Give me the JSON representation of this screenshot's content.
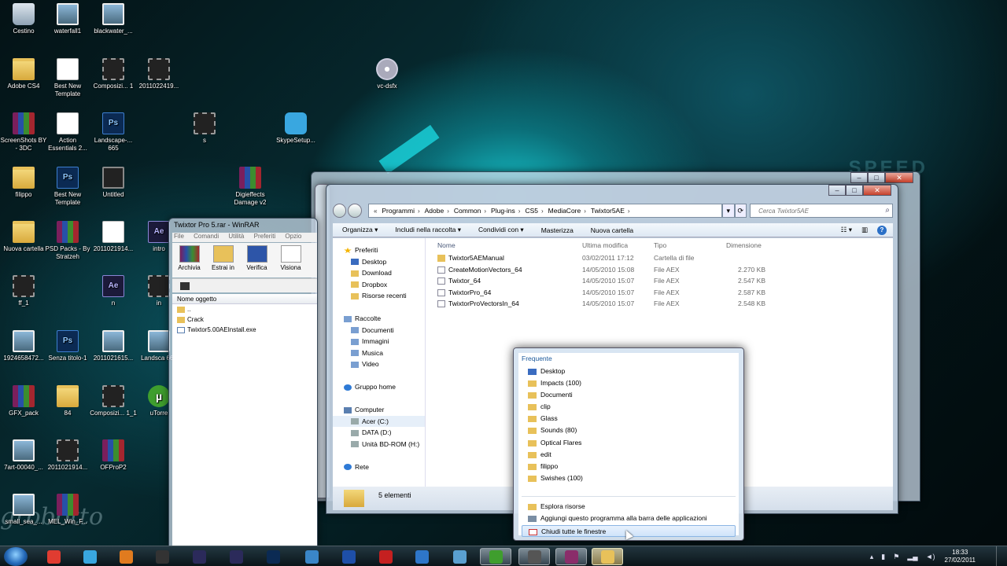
{
  "desktop": {
    "watermark": "grobotto",
    "wallpaper_text": "SPEED",
    "icons": [
      {
        "label": "Cestino",
        "icon": "trash-icon"
      },
      {
        "label": "waterfall1",
        "icon": "image-icon"
      },
      {
        "label": "blackwater_...",
        "icon": "image-icon"
      },
      {
        "label": "Adobe CS4",
        "icon": "folder-icon"
      },
      {
        "label": "Best New Template",
        "icon": "document-icon"
      },
      {
        "label": "Composizi... 1",
        "icon": "video-icon"
      },
      {
        "label": "2011022419...",
        "icon": "video-icon"
      },
      {
        "label": "vc-dsfx",
        "icon": "disc-icon"
      },
      {
        "label": "ScreenShots BY - 3DC",
        "icon": "rar-icon"
      },
      {
        "label": "Action Essentials 2...",
        "icon": "document-icon"
      },
      {
        "label": "Landscape-... 665",
        "icon": "psd-icon"
      },
      {
        "label": "s",
        "icon": "video-icon"
      },
      {
        "label": "SkypeSetup...",
        "icon": "skype-icon"
      },
      {
        "label": "filippo",
        "icon": "folder-icon"
      },
      {
        "label": "Best New Template",
        "icon": "psd-icon"
      },
      {
        "label": "Untitled",
        "icon": "monitor-icon"
      },
      {
        "label": "Digieffects Damage v2",
        "icon": "rar-icon"
      },
      {
        "label": "Nuova cartella",
        "icon": "folder-icon"
      },
      {
        "label": "PSD Packs - By Stratzeh",
        "icon": "rar-icon"
      },
      {
        "label": "2011021914...",
        "icon": "document-icon"
      },
      {
        "label": "intro",
        "icon": "ae-icon"
      },
      {
        "label": "ff_1",
        "icon": "video-icon"
      },
      {
        "label": "n",
        "icon": "ae-icon"
      },
      {
        "label": "in",
        "icon": "video-icon"
      },
      {
        "label": "1924658472...",
        "icon": "image-icon"
      },
      {
        "label": "Senza titolo-1",
        "icon": "psd-icon"
      },
      {
        "label": "2011021615...",
        "icon": "image-icon"
      },
      {
        "label": "Landsca 665",
        "icon": "image-icon"
      },
      {
        "label": "GFX_pack",
        "icon": "rar-icon"
      },
      {
        "label": "84",
        "icon": "folder-icon"
      },
      {
        "label": "Composizi... 1_1",
        "icon": "video-icon"
      },
      {
        "label": "uTorre",
        "icon": "utorrent-icon"
      },
      {
        "label": "7art-00040_...",
        "icon": "image-icon"
      },
      {
        "label": "2011021914...",
        "icon": "video-icon"
      },
      {
        "label": "OFProP2",
        "icon": "rar-icon"
      },
      {
        "label": "small_sea_...",
        "icon": "image-icon"
      },
      {
        "label": "MEL_Win_F...",
        "icon": "rar-icon"
      }
    ]
  },
  "winrar": {
    "title": "Twixtor Pro 5.rar - WinRAR",
    "menu": [
      "File",
      "Comandi",
      "Utilità",
      "Preferiti",
      "Opzio"
    ],
    "tools": [
      "Archivia",
      "Estrai in",
      "Verifica",
      "Visiona"
    ],
    "column_header": "Nome oggetto",
    "rows": [
      "..",
      "Crack",
      "Twixtor5.00AEInstall.exe"
    ]
  },
  "explorer": {
    "breadcrumb": [
      "Programmi",
      "Adobe",
      "Common",
      "Plug-ins",
      "CS5",
      "MediaCore",
      "Twixtor5AE"
    ],
    "breadcrumb_prefix": "«",
    "search_placeholder": "Cerca Twixtor5AE",
    "commands": [
      "Organizza ▾",
      "Includi nella raccolta ▾",
      "Condividi con ▾",
      "Masterizza",
      "Nuova cartella"
    ],
    "nav": {
      "favorites": {
        "label": "Preferiti",
        "items": [
          "Desktop",
          "Download",
          "Dropbox",
          "Risorse recenti"
        ]
      },
      "libraries": {
        "label": "Raccolte",
        "items": [
          "Documenti",
          "Immagini",
          "Musica",
          "Video"
        ]
      },
      "homegroup": "Gruppo home",
      "computer": {
        "label": "Computer",
        "items": [
          "Acer (C:)",
          "DATA (D:)",
          "Unità BD-ROM (H:)"
        ]
      },
      "network": "Rete"
    },
    "columns": [
      "Nome",
      "Ultima modifica",
      "Tipo",
      "Dimensione"
    ],
    "files": [
      {
        "name": "Twixtor5AEManual",
        "date": "03/02/2011 17:12",
        "type": "Cartella di file",
        "size": "",
        "kind": "folder"
      },
      {
        "name": "CreateMotionVectors_64",
        "date": "14/05/2010 15:08",
        "type": "File AEX",
        "size": "2.270 KB",
        "kind": "aex"
      },
      {
        "name": "Twixtor_64",
        "date": "14/05/2010 15:07",
        "type": "File AEX",
        "size": "2.547 KB",
        "kind": "aex"
      },
      {
        "name": "TwixtorPro_64",
        "date": "14/05/2010 15:07",
        "type": "File AEX",
        "size": "2.587 KB",
        "kind": "aex"
      },
      {
        "name": "TwixtorProVectorsIn_64",
        "date": "14/05/2010 15:07",
        "type": "File AEX",
        "size": "2.548 KB",
        "kind": "aex"
      }
    ],
    "status": "5 elementi"
  },
  "jumplist": {
    "title": "Frequente",
    "items": [
      "Desktop",
      "Impacts (100)",
      "Documenti",
      "clip",
      "Glass",
      "Sounds (80)",
      "Optical Flares",
      "edit",
      "filippo",
      "Swishes (100)"
    ],
    "tasks": [
      "Esplora risorse",
      "Aggiungi questo programma alla barra delle applicazioni",
      "Chiudi tutte le finestre"
    ]
  },
  "taskbar": {
    "clock_time": "18:33",
    "clock_date": "27/02/2011",
    "apps": [
      "Chrome",
      "Skype",
      "Firefox",
      "Monitor",
      "After Effects",
      "After Effects",
      "Photoshop",
      "Ice",
      "Earth",
      "Angry",
      "Flash",
      "Network",
      "uTorrent",
      "Explorer archive",
      "WinRAR",
      "Esplora risorse"
    ]
  }
}
